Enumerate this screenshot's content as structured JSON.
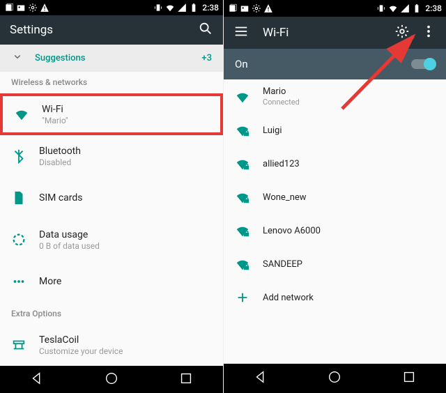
{
  "status": {
    "time": "2:38"
  },
  "left": {
    "app_title": "Settings",
    "suggestions_label": "Suggestions",
    "suggestions_count": "+3",
    "section_wireless": "Wireless & networks",
    "wifi_label": "Wi-Fi",
    "wifi_sub": "\"Mario\"",
    "bt_label": "Bluetooth",
    "bt_sub": "Disabled",
    "sim_label": "SIM cards",
    "data_label": "Data usage",
    "data_sub": "0 B of data used",
    "more_label": "More",
    "section_extra": "Extra Options",
    "tesla_label": "TeslaCoil",
    "tesla_sub": "Customize your device"
  },
  "right": {
    "app_title": "Wi-Fi",
    "state_label": "On",
    "networks": [
      {
        "name": "Mario",
        "sub": "Connected"
      },
      {
        "name": "Luigi",
        "sub": ""
      },
      {
        "name": "allied123",
        "sub": ""
      },
      {
        "name": "Wone_new",
        "sub": ""
      },
      {
        "name": "Lenovo A6000",
        "sub": ""
      },
      {
        "name": "SANDEEP",
        "sub": ""
      }
    ],
    "add_label": "Add network"
  }
}
